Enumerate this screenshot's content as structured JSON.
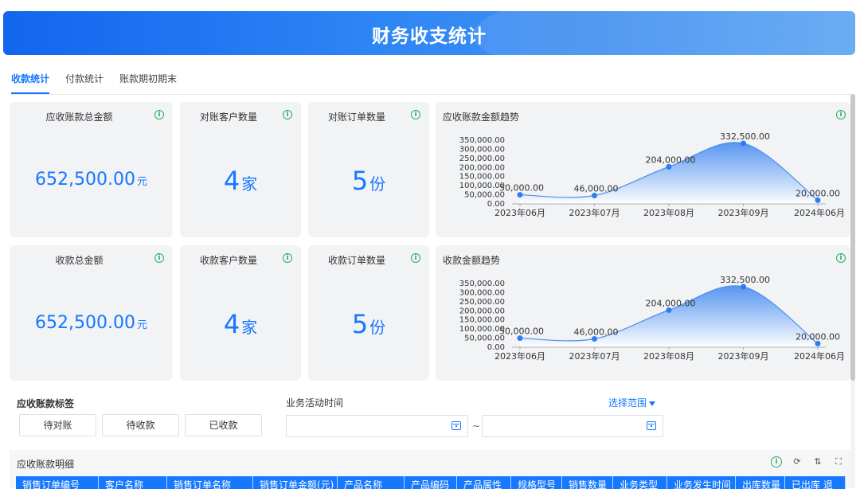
{
  "banner": {
    "title": "财务收支统计"
  },
  "tabs": [
    {
      "label": "收款统计",
      "active": true
    },
    {
      "label": "付款统计",
      "active": false
    },
    {
      "label": "账款期初期末",
      "active": false
    }
  ],
  "row1": {
    "total_receivable": {
      "title": "应收账款总金额",
      "value": "652,500.00",
      "unit": "元"
    },
    "reconcile_customers": {
      "title": "对账客户数量",
      "value": "4",
      "unit": "家"
    },
    "reconcile_orders": {
      "title": "对账订单数量",
      "value": "5",
      "unit": "份"
    },
    "trend": {
      "title": "应收账款金额趋势"
    }
  },
  "row2": {
    "total_received": {
      "title": "收款总金额",
      "value": "652,500.00",
      "unit": "元"
    },
    "received_customers": {
      "title": "收款客户数量",
      "value": "4",
      "unit": "家"
    },
    "received_orders": {
      "title": "收款订单数量",
      "value": "5",
      "unit": "份"
    },
    "trend": {
      "title": "收款金额趋势"
    }
  },
  "chart_data": [
    {
      "type": "area",
      "title": "应收账款金额趋势",
      "categories": [
        "2023年06月",
        "2023年07月",
        "2023年08月",
        "2023年09月",
        "2024年06月"
      ],
      "values": [
        50000,
        46000,
        204000,
        332500,
        20000
      ],
      "labels": [
        "50,000.00",
        "46,000.00",
        "204,000.00",
        "332,500.00",
        "20,000.00"
      ],
      "yticks": [
        "350,000.00",
        "300,000.00",
        "250,000.00",
        "200,000.00",
        "150,000.00",
        "100,000.00",
        "50,000.00",
        "0.00"
      ],
      "ylim": [
        0,
        350000
      ],
      "color": "#4a8ef0"
    },
    {
      "type": "area",
      "title": "收款金额趋势",
      "categories": [
        "2023年06月",
        "2023年07月",
        "2023年08月",
        "2023年09月",
        "2024年06月"
      ],
      "values": [
        50000,
        46000,
        204000,
        332500,
        20000
      ],
      "labels": [
        "50,000.00",
        "46,000.00",
        "204,000.00",
        "332,500.00",
        "20,000.00"
      ],
      "yticks": [
        "350,000.00",
        "300,000.00",
        "250,000.00",
        "200,000.00",
        "150,000.00",
        "100,000.00",
        "50,000.00",
        "0.00"
      ],
      "ylim": [
        0,
        350000
      ],
      "color": "#4a8ef0"
    }
  ],
  "filters": {
    "tag_label": "应收账款标签",
    "tags": [
      "待对账",
      "待收款",
      "已收款"
    ],
    "time_label": "业务活动时间",
    "range_select": "选择范围",
    "separator": "~"
  },
  "detail": {
    "title": "应收账款明细",
    "columns": [
      "销售订单编号",
      "客户名称",
      "销售订单名称",
      "销售订单金额(元)",
      "产品名称",
      "产品编码",
      "产品属性",
      "规格型号",
      "销售数量",
      "业务类型",
      "业务发生时间",
      "出库数量",
      "已出库 退"
    ]
  },
  "colors": {
    "accent": "#1677ff",
    "info": "#27ae60"
  }
}
